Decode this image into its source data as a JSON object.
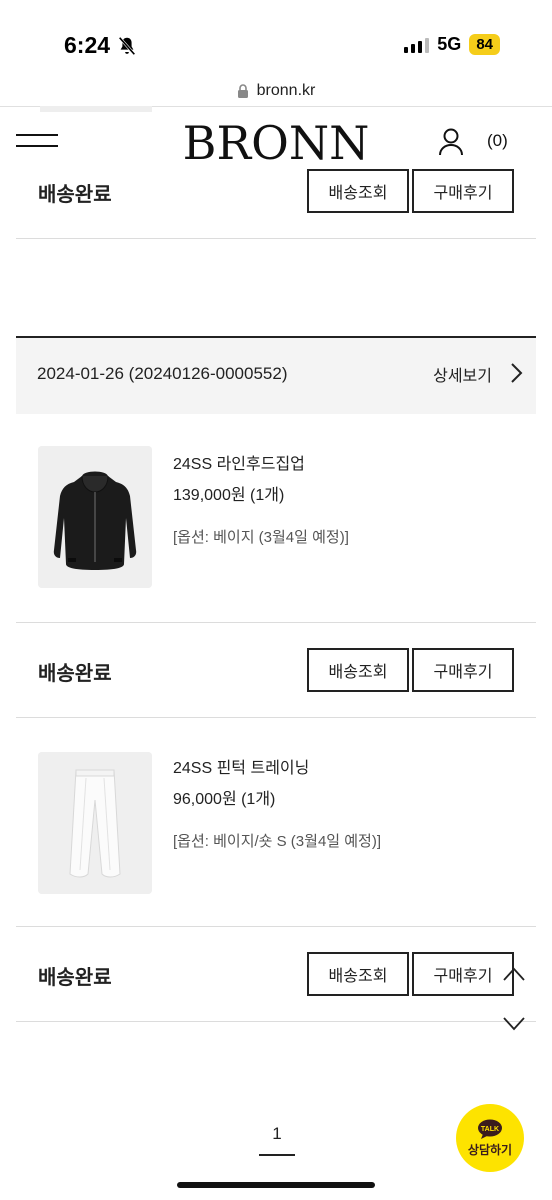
{
  "status_bar": {
    "time": "6:24",
    "network": "5G",
    "battery": "84"
  },
  "browser": {
    "url": "bronn.kr"
  },
  "header": {
    "logo": "BRONN",
    "cart_count": "(0)"
  },
  "shipping_rows": [
    {
      "status": "배송완료",
      "track_label": "배송조회",
      "review_label": "구매후기"
    },
    {
      "status": "배송완료",
      "track_label": "배송조회",
      "review_label": "구매후기"
    },
    {
      "status": "배송완료",
      "track_label": "배송조회",
      "review_label": "구매후기"
    }
  ],
  "order": {
    "date_number": "2024-01-26 (20240126-0000552)",
    "detail_label": "상세보기"
  },
  "products": [
    {
      "name": "24SS 라인후드집업",
      "price": "139,000원 (1개)",
      "option": "[옵션: 베이지 (3월4일 예정)]",
      "image_icon": "black-hoodie"
    },
    {
      "name": "24SS 핀턱 트레이닝",
      "price": "96,000원 (1개)",
      "option": "[옵션: 베이지/숏 S (3월4일 예정)]",
      "image_icon": "white-pants"
    }
  ],
  "pagination": {
    "current_page": "1"
  },
  "kakao": {
    "badge": "TALK",
    "label": "상담하기",
    "color": "#fde300"
  }
}
